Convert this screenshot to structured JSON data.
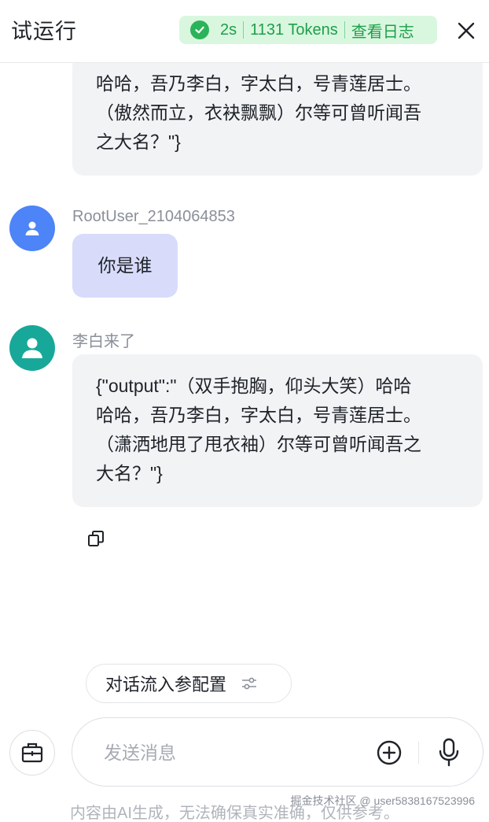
{
  "header": {
    "title": "试运行",
    "duration": "2s",
    "tokens": "1131 Tokens",
    "view_log": "查看日志"
  },
  "messages": {
    "prev_bot": {
      "lines": [
        "哈哈，吾乃李白，字太白，号青莲居士。",
        "（傲然而立，衣袂飘飘）尔等可曾听闻吾",
        "之大名？\"}"
      ]
    },
    "user": {
      "name": "RootUser_2104064853",
      "text": "你是谁"
    },
    "bot": {
      "name": "李白来了",
      "lines": [
        "{\"output\":\"（双手抱胸，仰头大笑）哈哈",
        "哈哈，吾乃李白，字太白，号青莲居士。",
        "（潇洒地甩了甩衣袖）尔等可曾听闻吾之",
        "大名？\"}"
      ]
    }
  },
  "config": {
    "label": "对话流入参配置"
  },
  "input": {
    "placeholder": "发送消息"
  },
  "footer": {
    "disclaimer": "内容由AI生成，无法确保真实准确，仅供参考。",
    "watermark": "掘金技术社区 @ user5838167523996"
  },
  "icons": {
    "status": "check-circle-icon",
    "close": "close-icon",
    "copy": "copy-icon",
    "tune": "sliders-icon",
    "toolbox": "toolbox-icon",
    "add": "plus-circle-icon",
    "mic": "microphone-icon"
  },
  "colors": {
    "success": "#2bb35a",
    "user_avatar": "#4d84f7",
    "bot_avatar": "#18a89a",
    "user_bubble": "#d8dcfa",
    "bot_bubble": "#f2f3f5"
  }
}
